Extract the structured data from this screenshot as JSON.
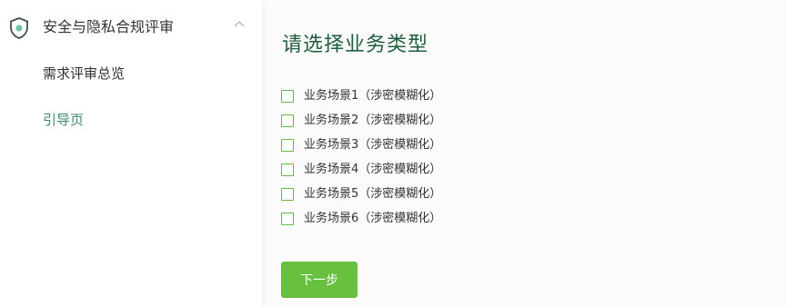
{
  "sidebar": {
    "group": {
      "label": "安全与隐私合规评审",
      "icon": "shield-icon",
      "expanded": true
    },
    "items": [
      {
        "label": "需求评审总览"
      },
      {
        "label": "引导页",
        "active": true
      }
    ]
  },
  "main": {
    "title": "请选择业务类型",
    "options": [
      {
        "label": "业务场景1（涉密模糊化）",
        "checked": false
      },
      {
        "label": "业务场景2（涉密模糊化）",
        "checked": false
      },
      {
        "label": "业务场景3（涉密模糊化）",
        "checked": false
      },
      {
        "label": "业务场景4（涉密模糊化）",
        "checked": false
      },
      {
        "label": "业务场景5（涉密模糊化）",
        "checked": false
      },
      {
        "label": "业务场景6（涉密模糊化）",
        "checked": false
      }
    ],
    "next_label": "下一步"
  },
  "colors": {
    "accent": "#67c13f",
    "title": "#1f5e3c",
    "active_item": "#3e8a68",
    "checkbox_border": "#67b84a"
  }
}
